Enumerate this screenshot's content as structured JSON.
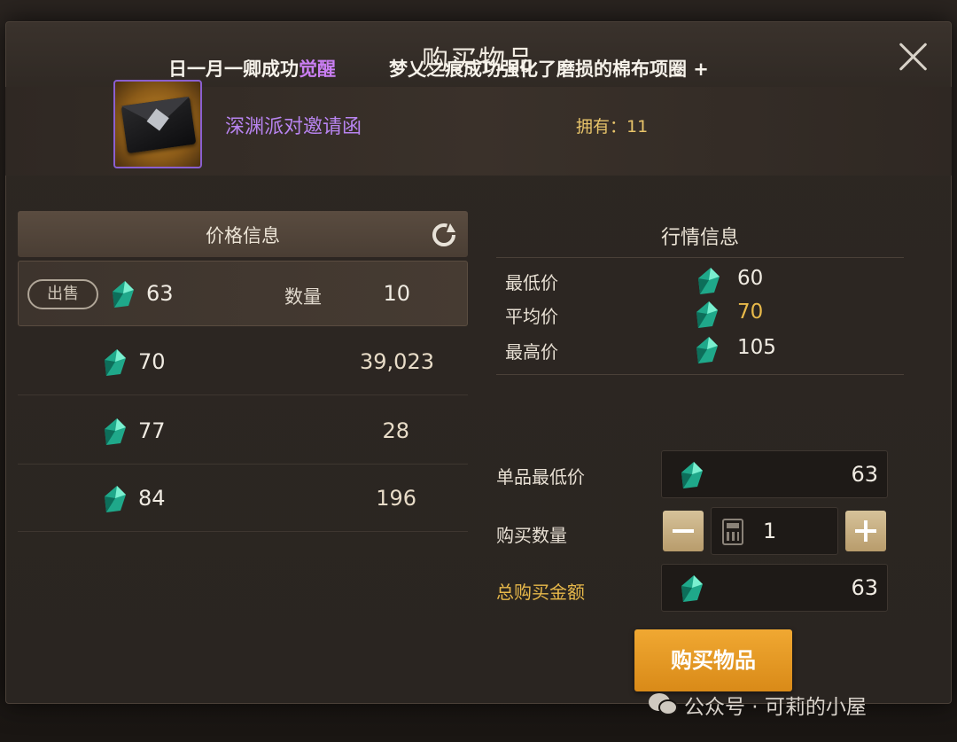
{
  "dialog": {
    "title": "购买物品",
    "ticker_part1_a": "日一月一卿成功",
    "ticker_part1_b": "觉醒",
    "ticker_part2": "梦乂之痕成功强化了磨损的棉布项圈 +"
  },
  "item": {
    "name": "深渊派对邀请函",
    "owned_label": "拥有：",
    "owned_value": "11"
  },
  "price_panel": {
    "header": "价格信息",
    "sell_label": "出售",
    "qty_label": "数量",
    "rows": [
      {
        "price": "63",
        "qty": "10"
      },
      {
        "price": "70",
        "qty": "39,023"
      },
      {
        "price": "77",
        "qty": "28"
      },
      {
        "price": "84",
        "qty": "196"
      }
    ]
  },
  "market": {
    "title": "行情信息",
    "items": [
      {
        "label": "最低价",
        "value": "60"
      },
      {
        "label": "平均价",
        "value": "70"
      },
      {
        "label": "最高价",
        "value": "105"
      }
    ]
  },
  "purchase": {
    "unit_min_label": "单品最低价",
    "unit_min_value": "63",
    "qty_label": "购买数量",
    "qty_value": "1",
    "total_label": "总购买金额",
    "total_value": "63",
    "buy_button": "购买物品"
  },
  "watermark": "公众号 · 可莉的小屋",
  "colors": {
    "accent_purple": "#b884f0",
    "gold": "#e8b94a",
    "buy_orange": "#f0a832"
  }
}
